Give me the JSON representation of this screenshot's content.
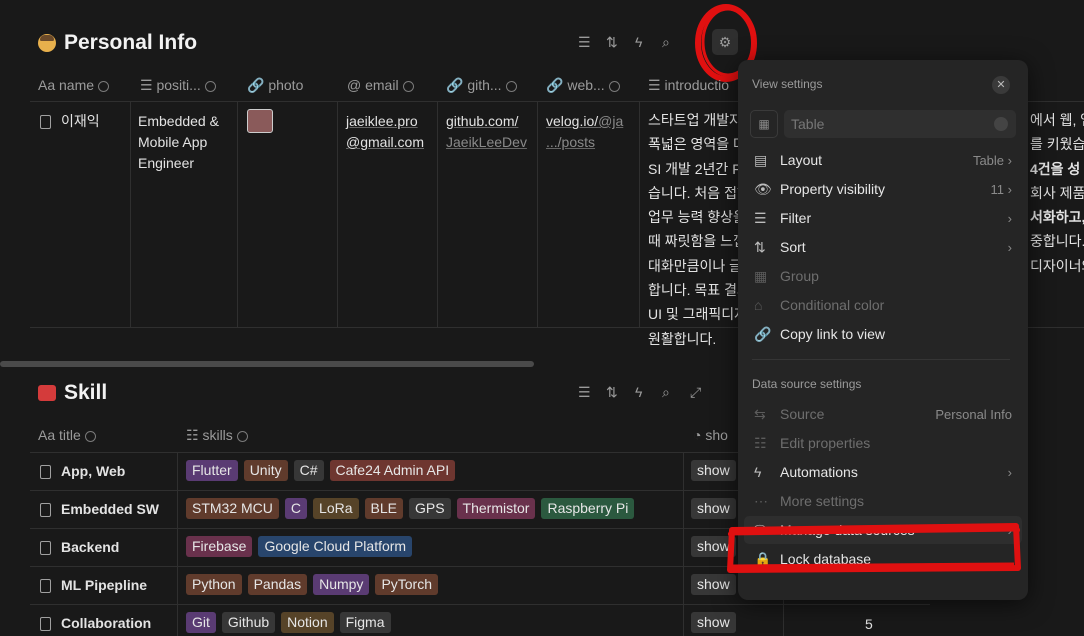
{
  "personal": {
    "title": "Personal Info",
    "cols": {
      "name": "name",
      "position": "positi...",
      "photo": "photo",
      "email": "email",
      "github": "gith...",
      "web": "web...",
      "intro": "introductio"
    },
    "row": {
      "name": "이재익",
      "position": [
        "Embedded &",
        "Mobile App",
        "Engineer"
      ],
      "email": [
        "jaeiklee.pro",
        "@gmail.com"
      ],
      "github": [
        "github.com/",
        "JaeikLeeDev"
      ],
      "web1a": "velog.io/",
      "web1b": "@ja",
      "web2": ".../posts",
      "intro": [
        "스타트업 개발자",
        "폭넓은 영역을 다",
        "SI 개발 2년간 F",
        "습니다. 처음 접하",
        "업무 능력 향상을",
        "때 짜릿함을 느낍",
        "대화만큼이나 글",
        "합니다. 목표 결과",
        "UI 및 그래픽디자",
        "원활합니다."
      ],
      "intro_right": [
        "에서 웹, 앱",
        "를 키웠습니",
        "4건을 성",
        "",
        "회사 제품",
        "",
        "서화하고,",
        "중합니다.",
        "디자이너와",
        ""
      ]
    }
  },
  "skill": {
    "title": "Skill",
    "cols": {
      "title": "title",
      "skills": "skills",
      "show": "sho"
    },
    "rows": [
      {
        "title": "App, Web",
        "tags": [
          {
            "t": "Flutter",
            "c": "purple"
          },
          {
            "t": "Unity",
            "c": "brown"
          },
          {
            "t": "C#",
            "c": "gray"
          },
          {
            "t": "Cafe24 Admin API",
            "c": "red"
          }
        ],
        "show": "show"
      },
      {
        "title": "Embedded SW",
        "tags": [
          {
            "t": "STM32 MCU",
            "c": "brown"
          },
          {
            "t": "C",
            "c": "purple"
          },
          {
            "t": "LoRa",
            "c": "olive"
          },
          {
            "t": "BLE",
            "c": "brown"
          },
          {
            "t": "GPS",
            "c": "gray"
          },
          {
            "t": "Thermistor",
            "c": "pink"
          },
          {
            "t": "Raspberry Pi",
            "c": "green"
          }
        ],
        "show": "show"
      },
      {
        "title": "Backend",
        "tags": [
          {
            "t": "Firebase",
            "c": "pink"
          },
          {
            "t": "Google Cloud Platform",
            "c": "blue"
          }
        ],
        "show": "show"
      },
      {
        "title": "ML Pipepline",
        "tags": [
          {
            "t": "Python",
            "c": "brown"
          },
          {
            "t": "Pandas",
            "c": "brown"
          },
          {
            "t": "Numpy",
            "c": "purple"
          },
          {
            "t": "PyTorch",
            "c": "brown"
          }
        ],
        "show": "show"
      },
      {
        "title": "Collaboration",
        "tags": [
          {
            "t": "Git",
            "c": "purple"
          },
          {
            "t": "Github",
            "c": "gray"
          },
          {
            "t": "Notion",
            "c": "olive"
          },
          {
            "t": "Figma",
            "c": "gray"
          }
        ],
        "show": "show",
        "num": "5"
      }
    ]
  },
  "menu": {
    "title": "View settings",
    "name_placeholder": "Table",
    "items": [
      {
        "label": "Layout",
        "value": "Table",
        "arrow": true
      },
      {
        "label": "Property visibility",
        "value": "11",
        "arrow": true
      },
      {
        "label": "Filter",
        "arrow": true
      },
      {
        "label": "Sort",
        "arrow": true
      },
      {
        "label": "Group",
        "disabled": true
      },
      {
        "label": "Conditional color",
        "disabled": true
      },
      {
        "label": "Copy link to view"
      }
    ],
    "ds_title": "Data source settings",
    "ds_items": [
      {
        "label": "Source",
        "value": "Personal Info",
        "disabled": true
      },
      {
        "label": "Edit properties",
        "disabled": true
      },
      {
        "label": "Automations",
        "arrow": true
      },
      {
        "label": "More settings",
        "disabled": true
      },
      {
        "label": "Manage data sources",
        "arrow": true
      },
      {
        "label": "Lock database"
      }
    ]
  },
  "colors": {
    "annotation": "#e01010",
    "bg": "#191919",
    "menu_bg": "#252525"
  }
}
